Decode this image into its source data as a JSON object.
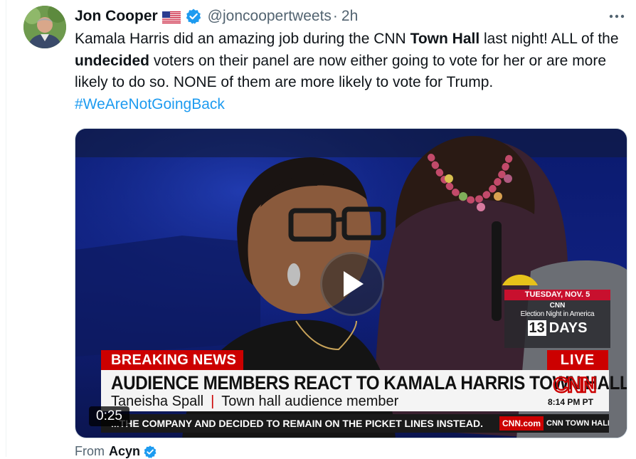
{
  "author": {
    "name": "Jon Cooper",
    "handle": "@joncoopertweets",
    "separator": "·",
    "time": "2h",
    "more_label": "···"
  },
  "tweet": {
    "t1": "Kamala Harris did an amazing job during the CNN ",
    "b1": "Town Hall",
    "t2": " last night! ALL of the ",
    "b2": "undecided",
    "t3": " voters on their panel are now either going to vote for her or are more likely to do so. NONE of them are more likely to vote for Trump.",
    "hashtag": "#WeAreNotGoingBack"
  },
  "video": {
    "duration": "0:25",
    "breaking_label": "BREAKING NEWS",
    "live_label": "LIVE",
    "headline": "AUDIENCE MEMBERS REACT TO KAMALA HARRIS TOWN HALL",
    "person_name": "Taneisha Spall",
    "name_separator": "|",
    "person_title": "Town hall audience member",
    "clock": "8:14 PM PT",
    "logo_text": "CNN",
    "ticker_text": "...THE COMPANY AND DECIDED TO REMAIN ON THE PICKET LINES INSTEAD.",
    "ticker_site": "CNN.com",
    "ticker_show": "CNN TOWN HALL",
    "promo": {
      "date": "TUESDAY, NOV. 5",
      "network": "CNN",
      "event": "Election Night in America",
      "days_number": "13",
      "days_label": "DAYS"
    }
  },
  "footer": {
    "from_label": "From",
    "from_name": "Acyn"
  },
  "colors": {
    "link": "#1d9bf0",
    "verified": "#1d9bf0",
    "cnn_red": "#cc0000",
    "muted": "#536471"
  }
}
